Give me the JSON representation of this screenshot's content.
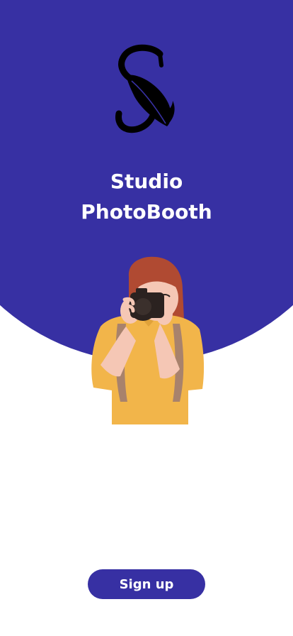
{
  "header": {
    "title_line1": "Studio",
    "title_line2": "PhotoBooth"
  },
  "logo": {
    "icon": "s-leaf-logo-icon"
  },
  "illustration": {
    "icon": "photographer-illustration"
  },
  "actions": {
    "signup_label": "Sign up"
  },
  "colors": {
    "brand": "#3730a3",
    "background": "#ffffff",
    "hair": "#b04a32",
    "shirt": "#f2b54a",
    "skin": "#f5c7b5",
    "strap": "#a8826c",
    "camera": "#2b2220"
  }
}
